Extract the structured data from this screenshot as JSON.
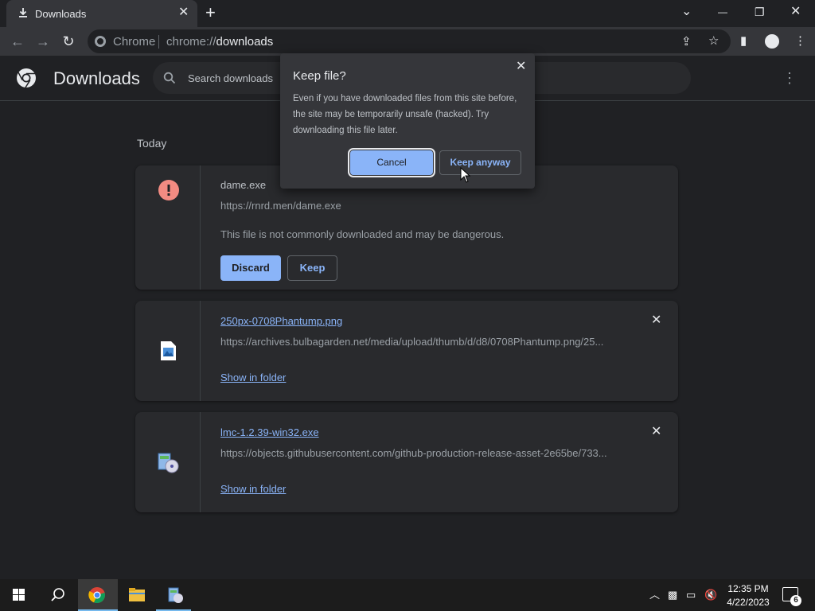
{
  "tab": {
    "title": "Downloads",
    "close": "✕",
    "new_tab": "+"
  },
  "window_controls": {
    "list": "⌄",
    "minimize": "—",
    "restore": "❐",
    "close": "✕"
  },
  "omnibox": {
    "site_chip": "Chrome",
    "url_prefix": "chrome://",
    "url_path": "downloads"
  },
  "header": {
    "title": "Downloads",
    "search_placeholder": "Search downloads",
    "menu": "⋮"
  },
  "section_label": "Today",
  "downloads": [
    {
      "filename": "dame.exe",
      "url": "https://rnrd.men/dame.exe",
      "warning": "This file is not commonly downloaded and may be dangerous.",
      "discard_label": "Discard",
      "keep_label": "Keep",
      "icon": "warning-icon"
    },
    {
      "filename": "250px-0708Phantump.png",
      "url": "https://archives.bulbagarden.net/media/upload/thumb/d/d8/0708Phantump.png/25...",
      "action": "Show in folder",
      "icon": "image-file-icon",
      "close": "✕"
    },
    {
      "filename": "lmc-1.2.39-win32.exe",
      "url": "https://objects.githubusercontent.com/github-production-release-asset-2e65be/733...",
      "action": "Show in folder",
      "icon": "installer-icon",
      "close": "✕"
    }
  ],
  "dialog": {
    "title": "Keep file?",
    "body": "Even if you have downloaded files from this site before, the site may be temporarily unsafe (hacked). Try downloading this file later.",
    "cancel_label": "Cancel",
    "keep_anyway_label": "Keep anyway",
    "close": "✕"
  },
  "taskbar": {
    "time": "12:35 PM",
    "date": "4/22/2023",
    "notifications": "6"
  },
  "colors": {
    "accent": "#8ab4f8",
    "warning": "#f28b82",
    "background": "#202124",
    "card": "#292a2d"
  }
}
